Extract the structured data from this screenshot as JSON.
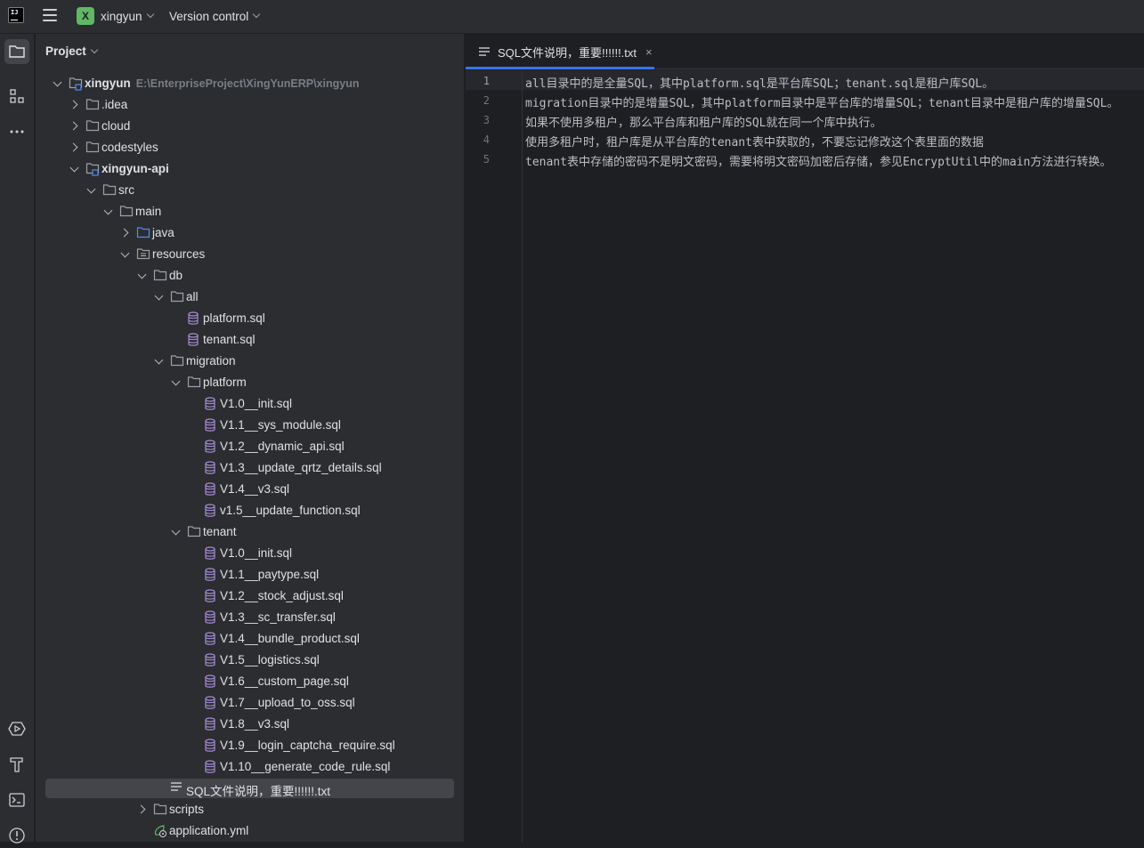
{
  "titlebar": {
    "project_badge": "X",
    "project_name": "xingyun",
    "vcs_label": "Version control"
  },
  "project_panel": {
    "title": "Project"
  },
  "tree": [
    {
      "label": "xingyun",
      "hint": "E:\\EnterpriseProject\\XingYunERP\\xingyun",
      "depth": 0,
      "arrow": "down",
      "icon": "module",
      "bold": true
    },
    {
      "label": ".idea",
      "depth": 1,
      "arrow": "right",
      "icon": "folder"
    },
    {
      "label": "cloud",
      "depth": 1,
      "arrow": "right",
      "icon": "folder"
    },
    {
      "label": "codestyles",
      "depth": 1,
      "arrow": "right",
      "icon": "folder"
    },
    {
      "label": "xingyun-api",
      "depth": 1,
      "arrow": "down",
      "icon": "module",
      "bold": true
    },
    {
      "label": "src",
      "depth": 2,
      "arrow": "down",
      "icon": "folder"
    },
    {
      "label": "main",
      "depth": 3,
      "arrow": "down",
      "icon": "folder"
    },
    {
      "label": "java",
      "depth": 4,
      "arrow": "right",
      "icon": "folder-src"
    },
    {
      "label": "resources",
      "depth": 4,
      "arrow": "down",
      "icon": "folder-res"
    },
    {
      "label": "db",
      "depth": 5,
      "arrow": "down",
      "icon": "folder"
    },
    {
      "label": "all",
      "depth": 6,
      "arrow": "down",
      "icon": "folder"
    },
    {
      "label": "platform.sql",
      "depth": 7,
      "arrow": "",
      "icon": "db"
    },
    {
      "label": "tenant.sql",
      "depth": 7,
      "arrow": "",
      "icon": "db"
    },
    {
      "label": "migration",
      "depth": 6,
      "arrow": "down",
      "icon": "folder"
    },
    {
      "label": "platform",
      "depth": 7,
      "arrow": "down",
      "icon": "folder"
    },
    {
      "label": "V1.0__init.sql",
      "depth": 8,
      "arrow": "",
      "icon": "db"
    },
    {
      "label": "V1.1__sys_module.sql",
      "depth": 8,
      "arrow": "",
      "icon": "db"
    },
    {
      "label": "V1.2__dynamic_api.sql",
      "depth": 8,
      "arrow": "",
      "icon": "db"
    },
    {
      "label": "V1.3__update_qrtz_details.sql",
      "depth": 8,
      "arrow": "",
      "icon": "db"
    },
    {
      "label": "V1.4__v3.sql",
      "depth": 8,
      "arrow": "",
      "icon": "db"
    },
    {
      "label": "v1.5__update_function.sql",
      "depth": 8,
      "arrow": "",
      "icon": "db"
    },
    {
      "label": "tenant",
      "depth": 7,
      "arrow": "down",
      "icon": "folder"
    },
    {
      "label": "V1.0__init.sql",
      "depth": 8,
      "arrow": "",
      "icon": "db"
    },
    {
      "label": "V1.1__paytype.sql",
      "depth": 8,
      "arrow": "",
      "icon": "db"
    },
    {
      "label": "V1.2__stock_adjust.sql",
      "depth": 8,
      "arrow": "",
      "icon": "db"
    },
    {
      "label": "V1.3__sc_transfer.sql",
      "depth": 8,
      "arrow": "",
      "icon": "db"
    },
    {
      "label": "V1.4__bundle_product.sql",
      "depth": 8,
      "arrow": "",
      "icon": "db"
    },
    {
      "label": "V1.5__logistics.sql",
      "depth": 8,
      "arrow": "",
      "icon": "db"
    },
    {
      "label": "V1.6__custom_page.sql",
      "depth": 8,
      "arrow": "",
      "icon": "db"
    },
    {
      "label": "V1.7__upload_to_oss.sql",
      "depth": 8,
      "arrow": "",
      "icon": "db"
    },
    {
      "label": "V1.8__v3.sql",
      "depth": 8,
      "arrow": "",
      "icon": "db"
    },
    {
      "label": "V1.9__login_captcha_require.sql",
      "depth": 8,
      "arrow": "",
      "icon": "db"
    },
    {
      "label": "V1.10__generate_code_rule.sql",
      "depth": 8,
      "arrow": "",
      "icon": "db"
    },
    {
      "label": "SQL文件说明，重要!!!!!!.txt",
      "depth": 6,
      "arrow": "",
      "icon": "text",
      "selected": true
    },
    {
      "label": "scripts",
      "depth": 5,
      "arrow": "right",
      "icon": "folder"
    },
    {
      "label": "application.yml",
      "depth": 5,
      "arrow": "",
      "icon": "yml"
    }
  ],
  "editor": {
    "tab_label": "SQL文件说明，重要!!!!!!.txt",
    "tab_close": "×",
    "lines": [
      "all目录中的是全量SQL，其中platform.sql是平台库SQL；tenant.sql是租户库SQL。",
      "migration目录中的是增量SQL，其中platform目录中是平台库的增量SQL；tenant目录中是租户库的增量SQL。",
      "如果不使用多租户，那么平台库和租户库的SQL就在同一个库中执行。",
      "使用多租户时，租户库是从平台库的tenant表中获取的，不要忘记修改这个表里面的数据",
      "tenant表中存储的密码不是明文密码，需要将明文密码加密后存储，参见EncryptUtil中的main方法进行转换。"
    ],
    "line_numbers": [
      "1",
      "2",
      "3",
      "4",
      "5"
    ]
  },
  "colors": {
    "folder": "#9da0a8",
    "db_icon": "#a88bd8",
    "module_badge": "#3574f0",
    "tab_underline": "#3574f0",
    "project_badge": "#5fb865"
  }
}
